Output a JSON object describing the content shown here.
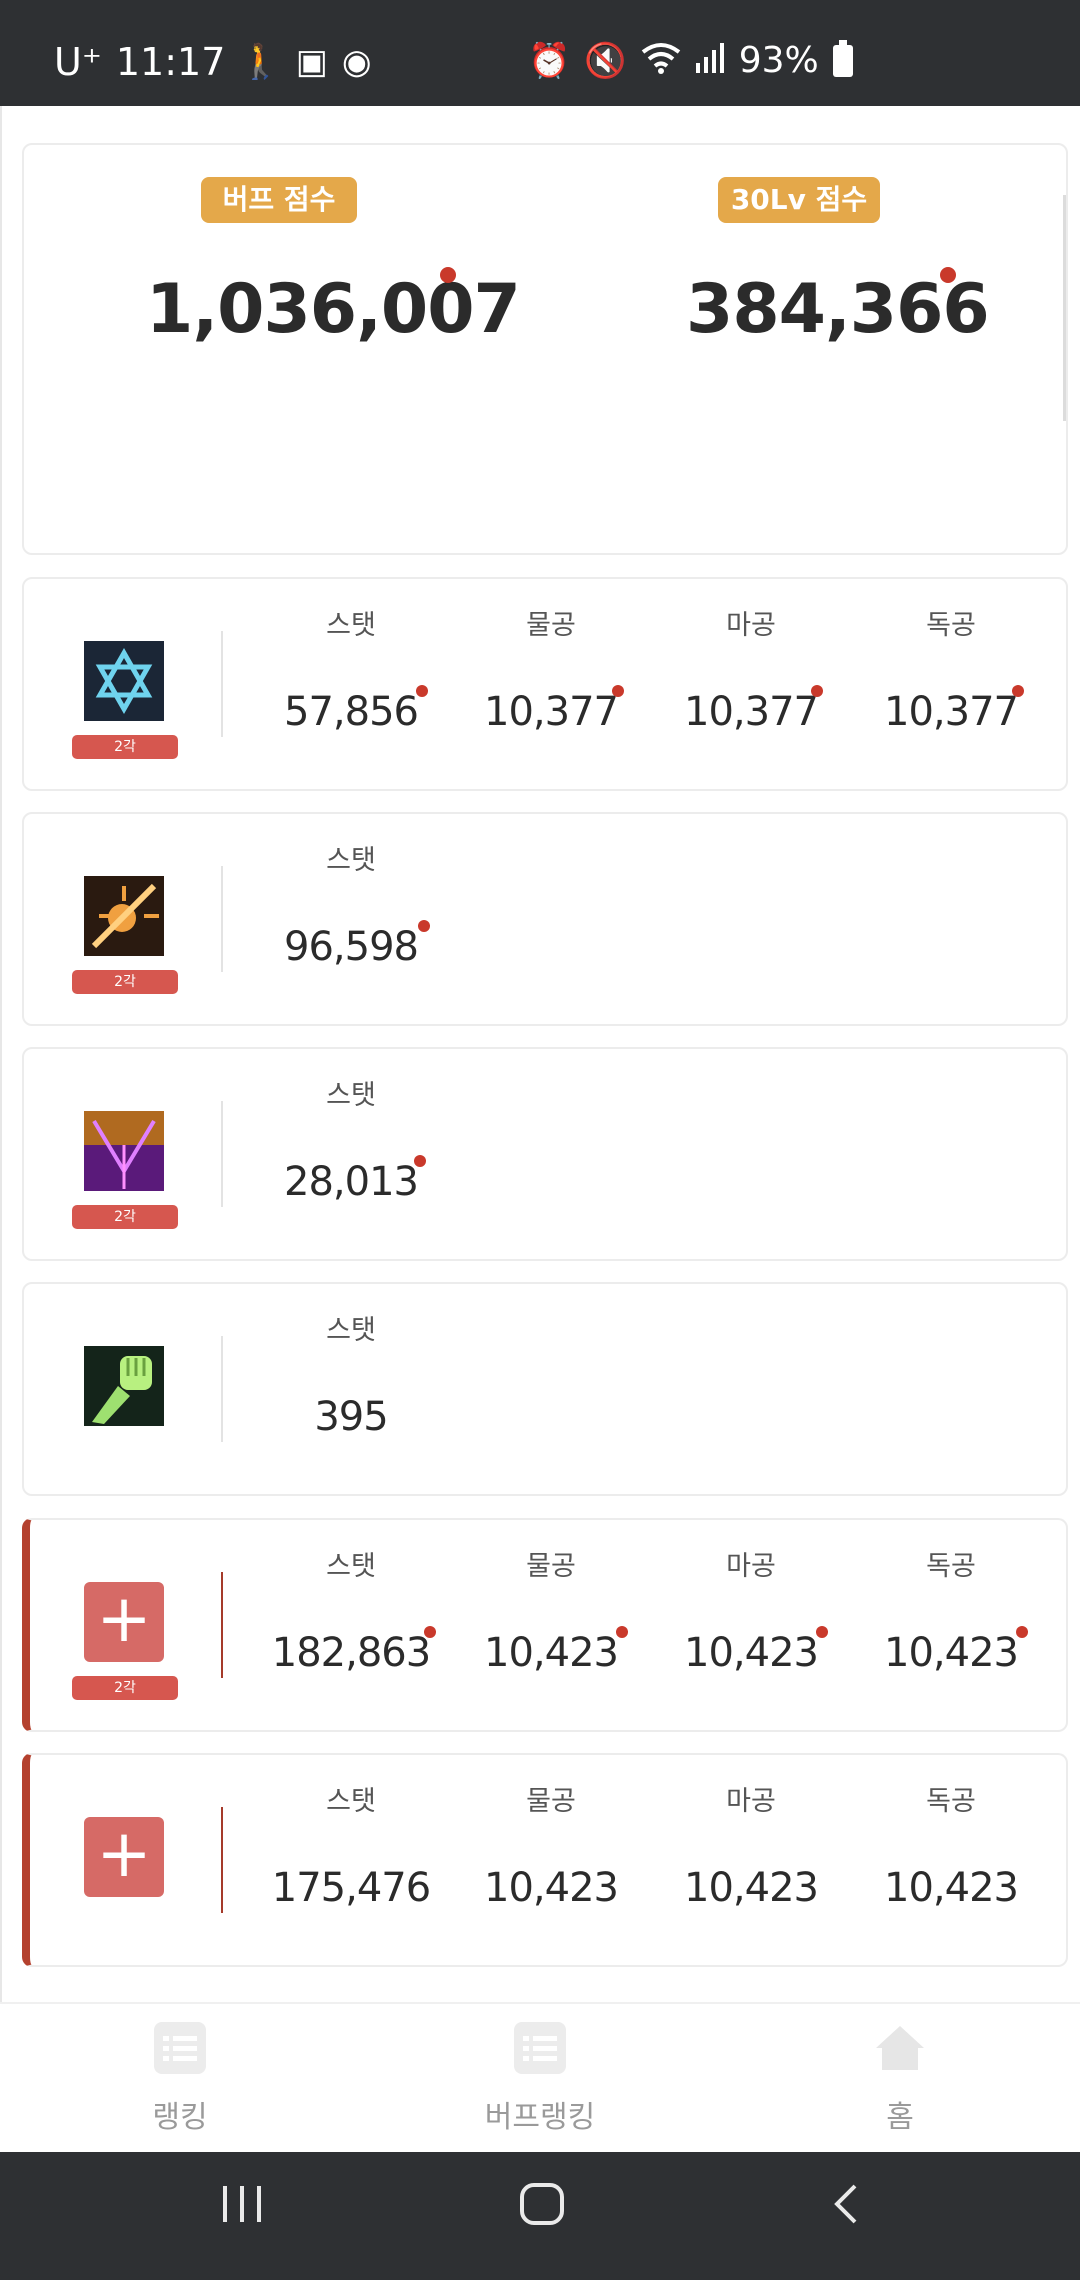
{
  "status_bar": {
    "carrier": "U⁺",
    "time": "11:17",
    "battery": "93%",
    "left_icons": [
      "walk-icon",
      "twitch-icon",
      "app-icon"
    ],
    "right_icons": [
      "alarm-icon",
      "mute-icon",
      "wifi-icon",
      "signal-icon",
      "battery-icon"
    ]
  },
  "scores": {
    "buff_label": "버프 점수",
    "buff_value": "1,036,007",
    "lv30_label": "30Lv 점수",
    "lv30_value": "384,366"
  },
  "tag_label": "2각",
  "cards": [
    {
      "icon": "hexagram-skill-icon",
      "has_tag": true,
      "stats": [
        {
          "label": "스탯",
          "value": "57,856",
          "dot": true
        },
        {
          "label": "물공",
          "value": "10,377",
          "dot": true
        },
        {
          "label": "마공",
          "value": "10,377",
          "dot": true
        },
        {
          "label": "독공",
          "value": "10,377",
          "dot": true
        }
      ]
    },
    {
      "icon": "sun-burst-skill-icon",
      "has_tag": true,
      "stats": [
        {
          "label": "스탯",
          "value": "96,598",
          "dot": true
        }
      ]
    },
    {
      "icon": "purple-crystal-skill-icon",
      "has_tag": true,
      "stats": [
        {
          "label": "스탯",
          "value": "28,013",
          "dot": true
        }
      ]
    },
    {
      "icon": "green-fist-skill-icon",
      "has_tag": false,
      "stats": [
        {
          "label": "스탯",
          "value": "395",
          "dot": false
        }
      ]
    },
    {
      "icon": "plus-icon",
      "has_tag": true,
      "stats": [
        {
          "label": "스탯",
          "value": "182,863",
          "dot": true
        },
        {
          "label": "물공",
          "value": "10,423",
          "dot": true
        },
        {
          "label": "마공",
          "value": "10,423",
          "dot": true
        },
        {
          "label": "독공",
          "value": "10,423",
          "dot": true
        }
      ]
    },
    {
      "icon": "plus-icon",
      "has_tag": false,
      "stats": [
        {
          "label": "스탯",
          "value": "175,476",
          "dot": false
        },
        {
          "label": "물공",
          "value": "10,423",
          "dot": false
        },
        {
          "label": "마공",
          "value": "10,423",
          "dot": false
        },
        {
          "label": "독공",
          "value": "10,423",
          "dot": false
        }
      ]
    }
  ],
  "bottom_nav": {
    "ranking": "랭킹",
    "buff_ranking": "버프랭킹",
    "home": "홈"
  },
  "colors": {
    "pill": "#e4a84a",
    "dot": "#c9392b",
    "tag": "#d6574f",
    "accent": "#b4412e",
    "plus_button": "#d66a66"
  }
}
